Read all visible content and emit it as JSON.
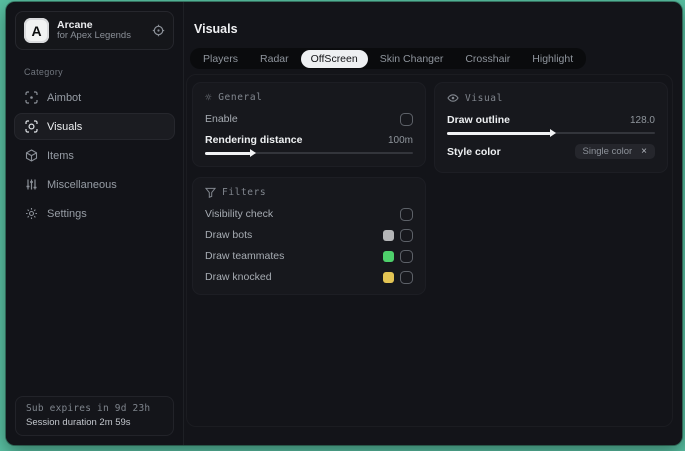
{
  "theme": {
    "background": "#58bfa1",
    "window_bg": "#101114",
    "panel_bg": "#17181d",
    "accent_white": "#f2f3f5"
  },
  "sidebar": {
    "app": {
      "logo_letter": "A",
      "name": "Arcane",
      "subtitle": "for Apex Legends"
    },
    "category_label": "Category",
    "items": [
      {
        "label": "Aimbot",
        "icon": "crosshair-icon",
        "selected": false
      },
      {
        "label": "Visuals",
        "icon": "scan-eye-icon",
        "selected": true
      },
      {
        "label": "Items",
        "icon": "cube-icon",
        "selected": false
      },
      {
        "label": "Miscellaneous",
        "icon": "sliders-icon",
        "selected": false
      },
      {
        "label": "Settings",
        "icon": "gear-icon",
        "selected": false
      }
    ],
    "footer": {
      "line1": "Sub expires in 9d 23h",
      "line2": "Session duration 2m 59s"
    }
  },
  "main": {
    "title": "Visuals",
    "tabs": [
      {
        "label": "Players",
        "selected": false
      },
      {
        "label": "Radar",
        "selected": false
      },
      {
        "label": "OffScreen",
        "selected": true
      },
      {
        "label": "Skin Changer",
        "selected": false
      },
      {
        "label": "Crosshair",
        "selected": false
      },
      {
        "label": "Highlight",
        "selected": false
      }
    ],
    "general": {
      "title": "General",
      "enable_label": "Enable",
      "enable_checked": false,
      "rendering_label": "Rendering distance",
      "rendering_value": "100m",
      "rendering_percent": 22
    },
    "filters": {
      "title": "Filters",
      "rows": [
        {
          "label": "Visibility check",
          "swatch": null,
          "checked": false
        },
        {
          "label": "Draw bots",
          "swatch": "#b4b5b7",
          "checked": false
        },
        {
          "label": "Draw teammates",
          "swatch": "#4ed06b",
          "checked": false
        },
        {
          "label": "Draw knocked",
          "swatch": "#e3c454",
          "checked": false
        }
      ]
    },
    "visual": {
      "title": "Visual",
      "outline_label": "Draw outline",
      "outline_value": "128.0",
      "outline_percent": 50,
      "style_label": "Style color",
      "style_chip_value": "Single color",
      "chip_close_glyph": "×"
    }
  }
}
